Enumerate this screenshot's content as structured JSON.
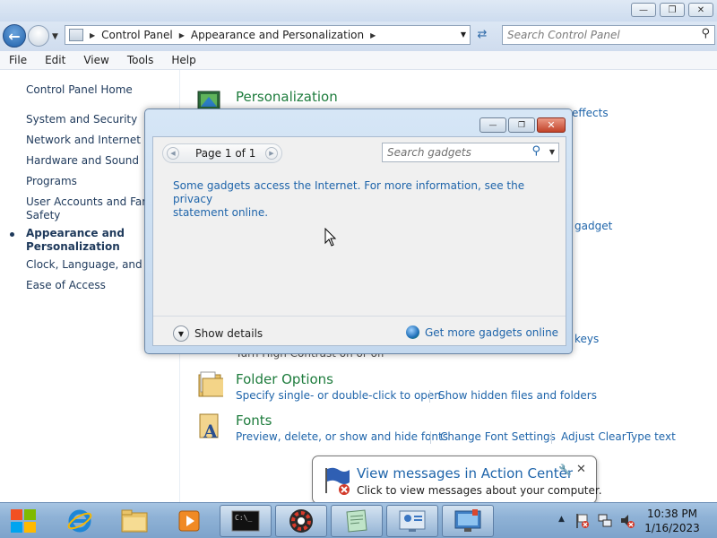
{
  "window": {
    "controls": {
      "minimize": "—",
      "maximize": "❐",
      "close": "✕"
    }
  },
  "nav": {
    "breadcrumb": [
      "Control Panel",
      "Appearance and Personalization"
    ],
    "search_placeholder": "Search Control Panel"
  },
  "menu": [
    "File",
    "Edit",
    "View",
    "Tools",
    "Help"
  ],
  "sidebar": {
    "items": [
      "Control Panel Home",
      "System and Security",
      "Network and Internet",
      "Hardware and Sound",
      "Programs",
      "User Accounts and Family",
      "Safety",
      "Appearance and",
      "Personalization",
      "Clock, Language, and Re",
      "Ease of Access"
    ]
  },
  "content": {
    "personalization": {
      "title": "Personalization",
      "partial_link": "effects"
    },
    "partial_links": {
      "gadget": "gadget",
      "keys": "keys",
      "hidden_text": "Turn High Contrast on or off"
    },
    "folder_options": {
      "title": "Folder Options",
      "links": [
        "Specify single- or double-click to open",
        "Show hidden files and folders"
      ]
    },
    "fonts": {
      "title": "Fonts",
      "links": [
        "Preview, delete, or show and hide fonts",
        "Change Font Settings",
        "Adjust ClearType text"
      ]
    }
  },
  "gadgets": {
    "controls": {
      "minimize": "—",
      "restore": "❐",
      "close": "✕"
    },
    "page_indicator": "Page 1 of 1",
    "search_placeholder": "Search gadgets",
    "info_line1": "Some gadgets access the Internet.  For more information, see the privacy",
    "info_line2": "statement online.",
    "show_details": "Show details",
    "get_more": "Get more gadgets online"
  },
  "balloon": {
    "title": "View messages in Action Center",
    "text": "Click to view messages about your computer."
  },
  "clock": {
    "time": "10:38 PM",
    "date": "1/16/2023"
  },
  "colors": {
    "link": "#1e64aa",
    "category_title": "#1e7c3d",
    "sidebar_text": "#1e395b",
    "taskbar": "#8fb2d6"
  }
}
